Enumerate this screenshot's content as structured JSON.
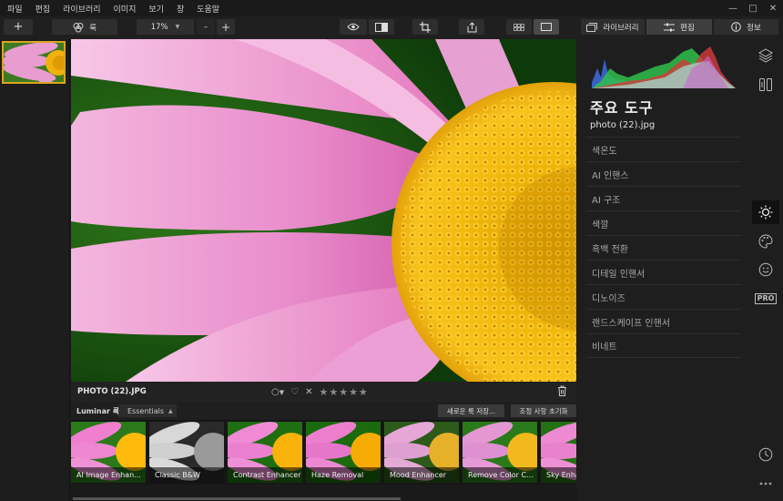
{
  "menu": [
    "파일",
    "편집",
    "라이브러리",
    "이미지",
    "보기",
    "창",
    "도움말"
  ],
  "toolbar": {
    "add_label": "+",
    "looks_label": "룩",
    "zoom_value": "17%",
    "zoom_minus": "–",
    "zoom_plus": "+"
  },
  "right_tabs": {
    "library": "라이브러리",
    "edit": "편집",
    "info": "정보",
    "active": "edit"
  },
  "image": {
    "filename": "PHOTO (22).JPG",
    "rating_stars": "★★★★★",
    "reject_mark": "✕"
  },
  "looks": {
    "label": "Luminar 룩:",
    "collection": "Essentials",
    "save_button": "새로운 룩 저장...",
    "reset_button": "조정 사항 초기화",
    "items": [
      {
        "name": "AI Image Enhan..."
      },
      {
        "name": "Classic B&W"
      },
      {
        "name": "Contrast Enhancer"
      },
      {
        "name": "Haze Removal"
      },
      {
        "name": "Mood Enhancer"
      },
      {
        "name": "Remove Color C..."
      },
      {
        "name": "Sky Enha"
      }
    ]
  },
  "panel": {
    "title": "주요 도구",
    "filename": "photo (22).jpg",
    "tools": [
      "색온도",
      "AI 인핸스",
      "AI 구조",
      "색깔",
      "흑백 전환",
      "디테일 인핸서",
      "디노이즈",
      "랜드스케이프 인핸서",
      "비네트"
    ]
  },
  "side_icons": [
    "layers-icon",
    "compare-icon",
    "sun-icon",
    "palette-icon",
    "face-icon",
    "pro-badge",
    "clock-icon",
    "more-icon"
  ],
  "side_pro_label": "PRO",
  "colors": {
    "accent_selection": "#d9a61e",
    "background": "#1c1c1c"
  }
}
